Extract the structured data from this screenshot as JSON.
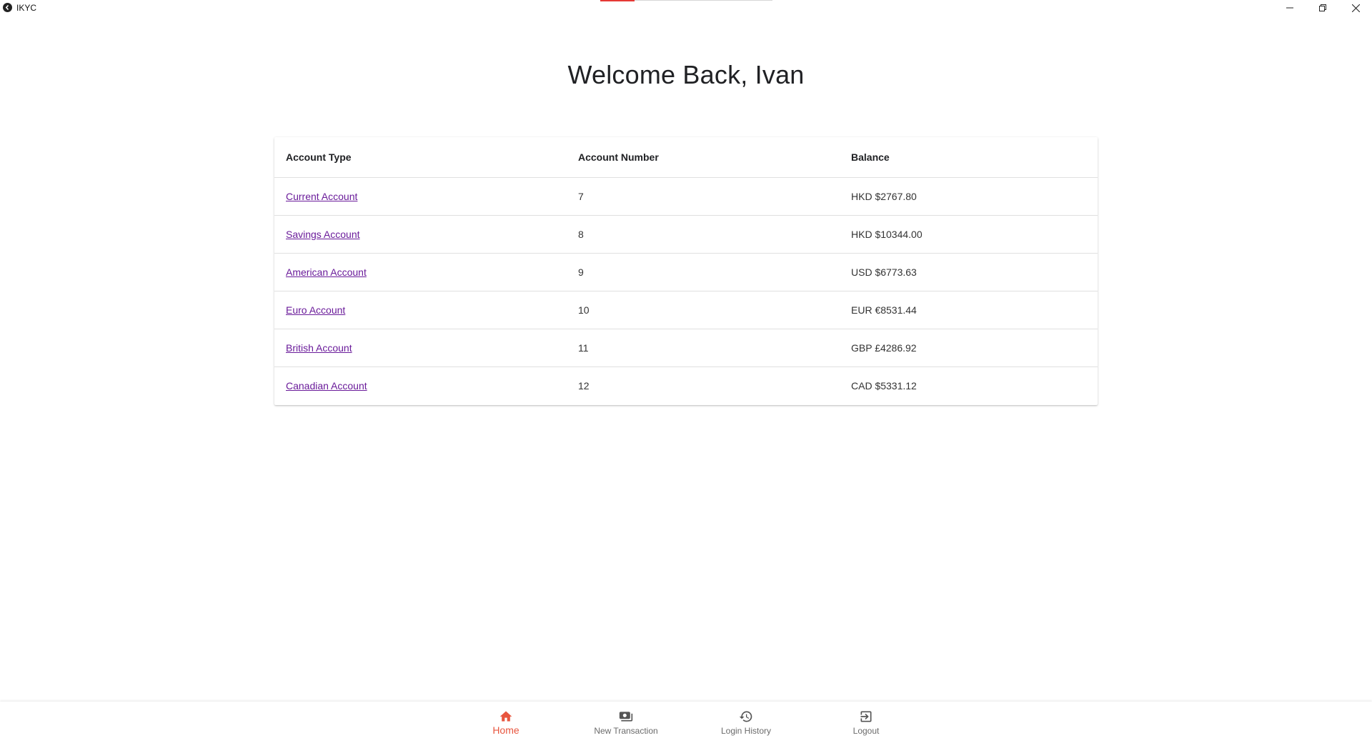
{
  "window": {
    "title": "IKYC",
    "progress_percent": 20
  },
  "heading": "Welcome Back, Ivan",
  "table": {
    "columns": [
      "Account Type",
      "Account Number",
      "Balance"
    ],
    "rows": [
      {
        "type": "Current Account",
        "number": "7",
        "balance": "HKD $2767.80"
      },
      {
        "type": "Savings Account",
        "number": "8",
        "balance": "HKD $10344.00"
      },
      {
        "type": "American Account",
        "number": "9",
        "balance": "USD $6773.63"
      },
      {
        "type": "Euro Account",
        "number": "10",
        "balance": "EUR €8531.44"
      },
      {
        "type": "British Account",
        "number": "11",
        "balance": "GBP £4286.92"
      },
      {
        "type": "Canadian Account",
        "number": "12",
        "balance": "CAD $5331.12"
      }
    ]
  },
  "nav": {
    "items": [
      {
        "label": "Home",
        "icon": "home-icon",
        "active": true
      },
      {
        "label": "New Transaction",
        "icon": "cash-icon",
        "active": false
      },
      {
        "label": "Login History",
        "icon": "history-icon",
        "active": false
      },
      {
        "label": "Logout",
        "icon": "logout-icon",
        "active": false
      }
    ]
  },
  "colors": {
    "active": "#e8553e",
    "link": "#6a1b9a",
    "progress": "#e53935"
  }
}
